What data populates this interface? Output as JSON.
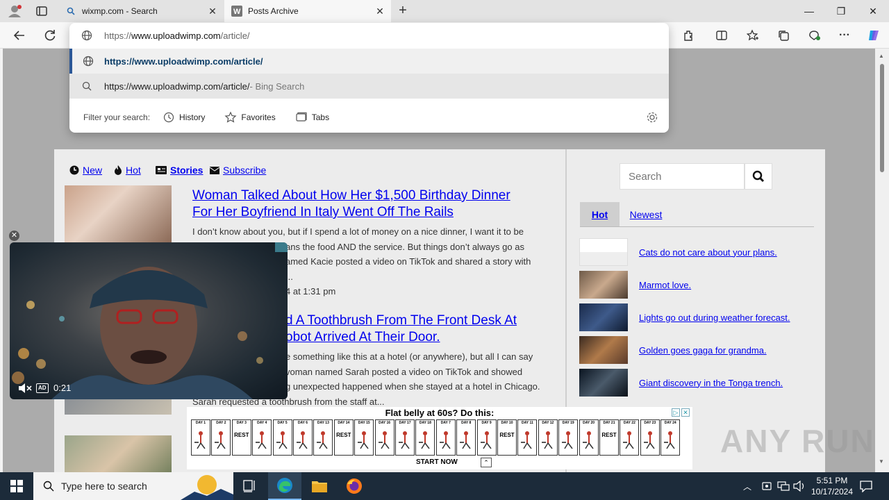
{
  "tabs": [
    {
      "title": "wixmp.com - Search",
      "active": false
    },
    {
      "title": "Posts Archive",
      "active": true
    }
  ],
  "window_controls": {
    "minimize": "—",
    "maximize": "❐",
    "close": "✕"
  },
  "address_bar": {
    "url_prefix": "https://",
    "url_host": "www.uploadwimp.com",
    "url_path": "/article/"
  },
  "omnibox": {
    "suggestion_url": "https://www.uploadwimp.com/article/",
    "search_query": "https://www.uploadwimp.com/article/",
    "search_suffix": " - Bing Search",
    "filter_label": "Filter your search:",
    "filters": [
      "History",
      "Favorites",
      "Tabs"
    ]
  },
  "site_nav": {
    "new": "New",
    "hot": "Hot",
    "stories": "Stories",
    "subscribe": "Subscribe"
  },
  "articles": [
    {
      "title_line1": "Woman Talked About How Her $1,500 Birthday Dinner",
      "title_line2": "For Her Boyfriend In Italy Went Off The Rails",
      "excerpt": [
        "I don’t know about you, but if I spend a lot of money on a nice dinner, I want it to be",
        "ans the food AND the service. But things don’t always go as",
        "amed Kacie posted a video on TikTok and shared a story with",
        "..."
      ],
      "meta": "4 at 1:31 pm"
    },
    {
      "title_line1": "d A Toothbrush From The Front Desk At",
      "title_line2": "obot Arrived At Their Door.",
      "excerpt": [
        "e something like this at a hotel (or anywhere), but all I can say",
        "voman named Sarah posted a video on TikTok and showed",
        "g unexpected happened when she stayed at a hotel in Chicago.",
        "Sarah requested a toothbrush from the staff at..."
      ]
    }
  ],
  "sidebar": {
    "search_placeholder": "Search",
    "tabs": [
      "Hot",
      "Newest"
    ],
    "items": [
      "Cats do not care about your plans.",
      "Marmot love.",
      "Lights go out during weather forecast.",
      "Golden goes gaga for grandma.",
      "Giant discovery in the Tonga trench."
    ]
  },
  "video": {
    "time": "0:21",
    "ad_badge": "AD"
  },
  "ad": {
    "headline": "Flat belly at 60s? Do this:",
    "cta": "START NOW",
    "days": [
      "DAY 1",
      "DAY 2",
      "DAY 3",
      "DAY 4",
      "DAY 5",
      "DAY 6",
      "DAY 13",
      "DAY 14",
      "DAY 15",
      "DAY 16",
      "DAY 17",
      "DAY 18",
      "DAY 7",
      "DAY 8",
      "DAY 9",
      "DAY 10",
      "DAY 11",
      "DAY 12",
      "DAY 19",
      "DAY 20",
      "DAY 21",
      "DAY 22",
      "DAY 23",
      "DAY 24"
    ],
    "rest_days": [
      "DAY 3",
      "DAY 14",
      "DAY 10",
      "DAY 21"
    ],
    "rest_label": "REST"
  },
  "watermark": "ANY RUN",
  "taskbar": {
    "search_placeholder": "Type here to search",
    "time": "5:51 PM",
    "date": "10/17/2024"
  },
  "colors": {
    "link": "#0000ee",
    "taskbar": "#1c2b3a",
    "page_bg": "#ababab"
  }
}
